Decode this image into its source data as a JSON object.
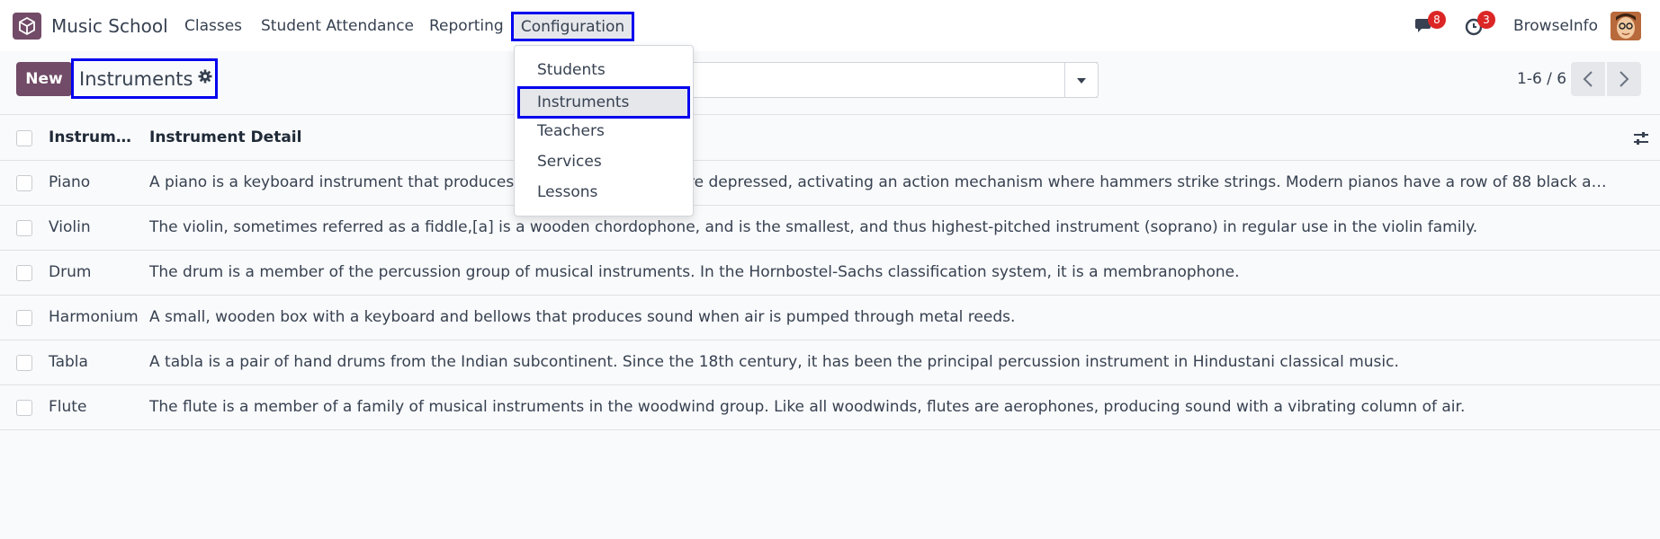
{
  "navbar": {
    "app_name": "Music School",
    "menu": {
      "classes": "Classes",
      "attendance": "Student Attendance",
      "reporting": "Reporting",
      "configuration": "Configuration"
    },
    "chat_count": "8",
    "activity_count": "3",
    "user_name": "BrowseInfo"
  },
  "control": {
    "new_label": "New",
    "breadcrumb_title": "Instruments",
    "search_placeholder": "",
    "pager_value": "1-6 / 6"
  },
  "dropdown": {
    "items": [
      "Students",
      "Instruments",
      "Teachers",
      "Services",
      "Lessons"
    ],
    "active_item": "Instruments"
  },
  "table": {
    "columns": [
      "Instrume…",
      "Instrument Detail"
    ],
    "rows": [
      {
        "name": "Piano",
        "detail": "A piano is a keyboard instrument that produces sound when its keys are depressed, activating an action mechanism where hammers strike strings. Modern pianos have a row of 88 black and white keys, tuned to a chromatic scale."
      },
      {
        "name": "Violin",
        "detail": "The violin, sometimes referred as a fiddle,[a] is a wooden chordophone, and is the smallest, and thus highest-pitched instrument (soprano) in regular use in the violin family."
      },
      {
        "name": "Drum",
        "detail": "The drum is a member of the percussion group of musical instruments. In the Hornbostel-Sachs classification system, it is a membranophone."
      },
      {
        "name": "Harmonium",
        "detail": "A small, wooden box with a keyboard and bellows that produces sound when air is pumped through metal reeds."
      },
      {
        "name": "Tabla",
        "detail": "A tabla is a pair of hand drums from the Indian subcontinent. Since the 18th century, it has been the principal percussion instrument in Hindustani classical music."
      },
      {
        "name": "Flute",
        "detail": "The flute is a member of a family of musical instruments in the woodwind group. Like all woodwinds, flutes are aerophones, producing sound with a vibrating column of air."
      }
    ]
  },
  "colors": {
    "brand": "#714b67",
    "highlight_border": "#0000ee",
    "badge": "#dc2626"
  }
}
